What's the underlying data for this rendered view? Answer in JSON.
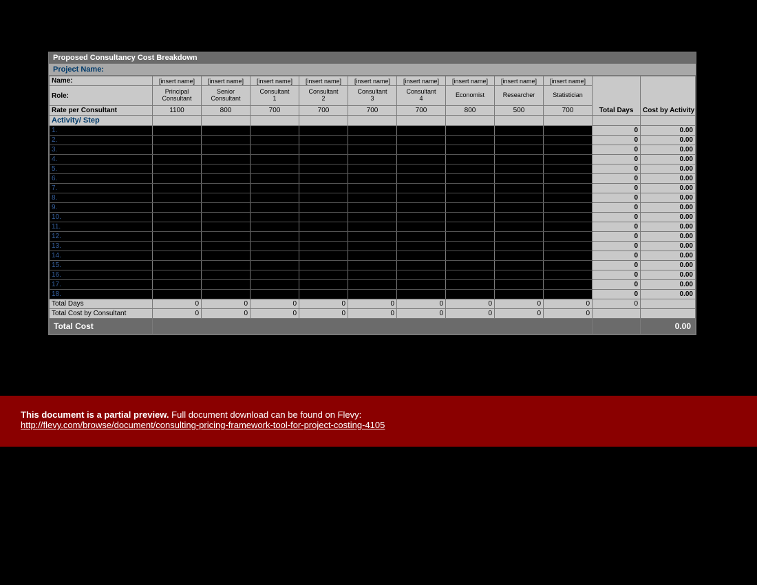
{
  "title": "Proposed Consultancy Cost Breakdown",
  "projectLabel": "Project Name:",
  "headerLabels": {
    "name": "Name:",
    "role": "Role:",
    "rate": "Rate per Consultant",
    "totalDays": "Total Days",
    "costByActivity": "Cost by Activity",
    "activity": "Activity/ Step"
  },
  "consultants": [
    {
      "name": "[insert name]",
      "role": "Principal Consultant",
      "rate": "1100"
    },
    {
      "name": "[insert name]",
      "role": "Senior Consultant",
      "rate": "800"
    },
    {
      "name": "[insert name]",
      "role": "Consultant 1",
      "rate": "700"
    },
    {
      "name": "[insert name]",
      "role": "Consultant 2",
      "rate": "700"
    },
    {
      "name": "[insert name]",
      "role": "Consultant 3",
      "rate": "700"
    },
    {
      "name": "[insert name]",
      "role": "Consultant 4",
      "rate": "700"
    },
    {
      "name": "[insert name]",
      "role": "Economist",
      "rate": "800"
    },
    {
      "name": "[insert name]",
      "role": "Researcher",
      "rate": "500"
    },
    {
      "name": "[insert name]",
      "role": "Statistician",
      "rate": "700"
    }
  ],
  "activities": [
    {
      "n": "1.",
      "td": "0",
      "c": "0.00"
    },
    {
      "n": "2.",
      "td": "0",
      "c": "0.00"
    },
    {
      "n": "3.",
      "td": "0",
      "c": "0.00"
    },
    {
      "n": "4.",
      "td": "0",
      "c": "0.00"
    },
    {
      "n": "5.",
      "td": "0",
      "c": "0.00"
    },
    {
      "n": "6.",
      "td": "0",
      "c": "0.00"
    },
    {
      "n": "7.",
      "td": "0",
      "c": "0.00"
    },
    {
      "n": "8.",
      "td": "0",
      "c": "0.00"
    },
    {
      "n": "9.",
      "td": "0",
      "c": "0.00"
    },
    {
      "n": "10.",
      "td": "0",
      "c": "0.00"
    },
    {
      "n": "11.",
      "td": "0",
      "c": "0.00"
    },
    {
      "n": "12.",
      "td": "0",
      "c": "0.00"
    },
    {
      "n": "13.",
      "td": "0",
      "c": "0.00"
    },
    {
      "n": "14.",
      "td": "0",
      "c": "0.00"
    },
    {
      "n": "15.",
      "td": "0",
      "c": "0.00"
    },
    {
      "n": "16.",
      "td": "0",
      "c": "0.00"
    },
    {
      "n": "17.",
      "td": "0",
      "c": "0.00"
    },
    {
      "n": "18.",
      "td": "0",
      "c": "0.00"
    }
  ],
  "footer": {
    "totalDaysLabel": "Total Days",
    "totalDaysValues": [
      "0",
      "0",
      "0",
      "0",
      "0",
      "0",
      "0",
      "0",
      "0",
      "0",
      ""
    ],
    "totalCostByConsultantLabel": "Total Cost by Consultant",
    "totalCostByConsultantValues": [
      "0",
      "0",
      "0",
      "0",
      "0",
      "0",
      "0",
      "0",
      "0",
      "",
      ""
    ]
  },
  "grand": {
    "label": "Total Cost",
    "value": "0.00"
  },
  "preview": {
    "bold": "This document is a partial preview.",
    "rest": "  Full document download can be found on Flevy:",
    "link": "http://flevy.com/browse/document/consulting-pricing-framework-tool-for-project-costing-4105"
  }
}
